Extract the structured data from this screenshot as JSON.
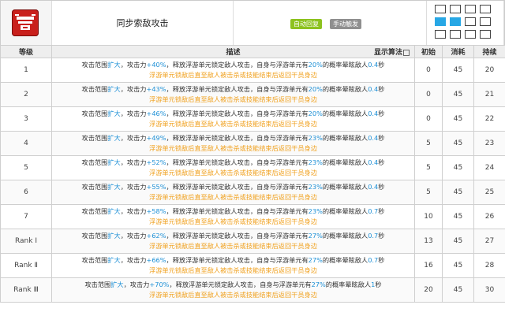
{
  "header": {
    "skill_name": "同步索敌攻击",
    "tags": {
      "auto": "自动回复",
      "manual": "手动触发"
    },
    "skill_icon": "target-lock-icon",
    "range_grid": {
      "rows": 3,
      "cols": 4,
      "active": [
        [
          1,
          0
        ],
        [
          1,
          1
        ]
      ]
    },
    "colors": {
      "tag_auto": "#8dc21f",
      "tag_manual": "#8f8f8f",
      "grid_active": "#27a7e5",
      "highlight": "#1e90d6",
      "note": "#f0a11f"
    }
  },
  "table": {
    "headers": {
      "level": "等级",
      "desc": "描述",
      "algo": "显示算法",
      "init": "初始",
      "cost": "消耗",
      "duration": "持续"
    },
    "rows": [
      {
        "level": "1",
        "d1a": "攻击范围",
        "d1b": "扩大",
        "d1c": "，攻击力",
        "d1d": "+40%",
        "d1e": "，释放浮游单元锁定敌人攻击，自身与浮游单元有",
        "d1f": "20%",
        "d1g": "的概率晕眩敌人",
        "d1h": "0.4",
        "d1i": "秒",
        "d2": "浮游单元锁敌后直至敌人被击杀或技能结束后返回干员身边",
        "init": "0",
        "cost": "45",
        "duration": "20"
      },
      {
        "level": "2",
        "d1a": "攻击范围",
        "d1b": "扩大",
        "d1c": "，攻击力",
        "d1d": "+43%",
        "d1e": "，释放浮游单元锁定敌人攻击，自身与浮游单元有",
        "d1f": "20%",
        "d1g": "的概率晕眩敌人",
        "d1h": "0.4",
        "d1i": "秒",
        "d2": "浮游单元锁敌后直至敌人被击杀或技能结束后返回干员身边",
        "init": "0",
        "cost": "45",
        "duration": "21"
      },
      {
        "level": "3",
        "d1a": "攻击范围",
        "d1b": "扩大",
        "d1c": "，攻击力",
        "d1d": "+46%",
        "d1e": "，释放浮游单元锁定敌人攻击，自身与浮游单元有",
        "d1f": "20%",
        "d1g": "的概率晕眩敌人",
        "d1h": "0.4",
        "d1i": "秒",
        "d2": "浮游单元锁敌后直至敌人被击杀或技能结束后返回干员身边",
        "init": "0",
        "cost": "45",
        "duration": "22"
      },
      {
        "level": "4",
        "d1a": "攻击范围",
        "d1b": "扩大",
        "d1c": "，攻击力",
        "d1d": "+49%",
        "d1e": "，释放浮游单元锁定敌人攻击，自身与浮游单元有",
        "d1f": "23%",
        "d1g": "的概率晕眩敌人",
        "d1h": "0.4",
        "d1i": "秒",
        "d2": "浮游单元锁敌后直至敌人被击杀或技能结束后返回干员身边",
        "init": "5",
        "cost": "45",
        "duration": "23"
      },
      {
        "level": "5",
        "d1a": "攻击范围",
        "d1b": "扩大",
        "d1c": "，攻击力",
        "d1d": "+52%",
        "d1e": "，释放浮游单元锁定敌人攻击，自身与浮游单元有",
        "d1f": "23%",
        "d1g": "的概率晕眩敌人",
        "d1h": "0.4",
        "d1i": "秒",
        "d2": "浮游单元锁敌后直至敌人被击杀或技能结束后返回干员身边",
        "init": "5",
        "cost": "45",
        "duration": "24"
      },
      {
        "level": "6",
        "d1a": "攻击范围",
        "d1b": "扩大",
        "d1c": "，攻击力",
        "d1d": "+55%",
        "d1e": "，释放浮游单元锁定敌人攻击，自身与浮游单元有",
        "d1f": "23%",
        "d1g": "的概率晕眩敌人",
        "d1h": "0.4",
        "d1i": "秒",
        "d2": "浮游单元锁敌后直至敌人被击杀或技能结束后返回干员身边",
        "init": "5",
        "cost": "45",
        "duration": "25"
      },
      {
        "level": "7",
        "d1a": "攻击范围",
        "d1b": "扩大",
        "d1c": "，攻击力",
        "d1d": "+58%",
        "d1e": "，释放浮游单元锁定敌人攻击，自身与浮游单元有",
        "d1f": "23%",
        "d1g": "的概率晕眩敌人",
        "d1h": "0.7",
        "d1i": "秒",
        "d2": "浮游单元锁敌后直至敌人被击杀或技能结束后返回干员身边",
        "init": "10",
        "cost": "45",
        "duration": "26"
      },
      {
        "level": "Rank Ⅰ",
        "d1a": "攻击范围",
        "d1b": "扩大",
        "d1c": "，攻击力",
        "d1d": "+62%",
        "d1e": "，释放浮游单元锁定敌人攻击，自身与浮游单元有",
        "d1f": "27%",
        "d1g": "的概率晕眩敌人",
        "d1h": "0.7",
        "d1i": "秒",
        "d2": "浮游单元锁敌后直至敌人被击杀或技能结束后返回干员身边",
        "init": "13",
        "cost": "45",
        "duration": "27"
      },
      {
        "level": "Rank Ⅱ",
        "d1a": "攻击范围",
        "d1b": "扩大",
        "d1c": "，攻击力",
        "d1d": "+66%",
        "d1e": "，释放浮游单元锁定敌人攻击，自身与浮游单元有",
        "d1f": "27%",
        "d1g": "的概率晕眩敌人",
        "d1h": "0.7",
        "d1i": "秒",
        "d2": "浮游单元锁敌后直至敌人被击杀或技能结束后返回干员身边",
        "init": "16",
        "cost": "45",
        "duration": "28"
      },
      {
        "level": "Rank Ⅲ",
        "d1a": "攻击范围",
        "d1b": "扩大",
        "d1c": "，攻击力",
        "d1d": "+70%",
        "d1e": "，释放浮游单元锁定敌人攻击，自身与浮游单元有",
        "d1f": "27%",
        "d1g": "的概率晕眩敌人",
        "d1h": "1",
        "d1i": "秒",
        "d2": "浮游单元锁敌后直至敌人被击杀或技能结束后返回干员身边",
        "init": "20",
        "cost": "45",
        "duration": "30"
      }
    ]
  }
}
